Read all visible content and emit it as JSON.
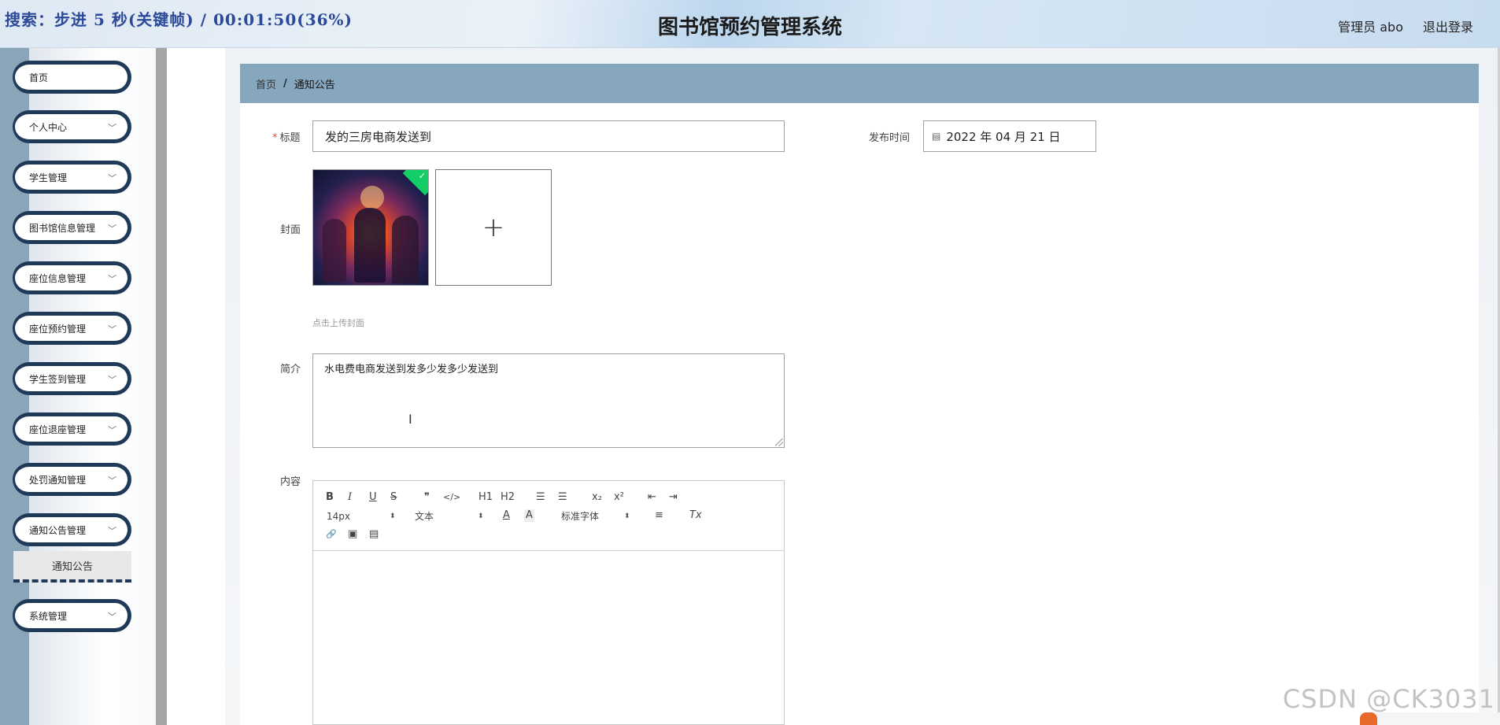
{
  "overlay_text": "搜索：步进 5 秒(关键帧) / 00:01:50(36%)",
  "header": {
    "title": "图书馆预约管理系统",
    "user": "管理员 abo",
    "logout": "退出登录"
  },
  "sidebar": {
    "items": [
      {
        "label": "首页",
        "has_arrow": false
      },
      {
        "label": "个人中心",
        "has_arrow": true
      },
      {
        "label": "学生管理",
        "has_arrow": true
      },
      {
        "label": "图书馆信息管理",
        "has_arrow": true
      },
      {
        "label": "座位信息管理",
        "has_arrow": true
      },
      {
        "label": "座位预约管理",
        "has_arrow": true
      },
      {
        "label": "学生签到管理",
        "has_arrow": true
      },
      {
        "label": "座位退座管理",
        "has_arrow": true
      },
      {
        "label": "处罚通知管理",
        "has_arrow": true
      },
      {
        "label": "通知公告管理",
        "has_arrow": true,
        "expanded": true
      },
      {
        "label": "系统管理",
        "has_arrow": true
      }
    ],
    "active_submenu": "通知公告"
  },
  "breadcrumb": {
    "home": "首页",
    "separator": "/",
    "current": "通知公告"
  },
  "form": {
    "title_label": "标题",
    "title_value": "发的三房电商发送到",
    "publish_time_label": "发布时间",
    "publish_time_value": "2022 年 04 月 21 日",
    "cover_label": "封面",
    "cover_hint": "点击上传封面",
    "summary_label": "简介",
    "summary_value": "水电费电商发送到发多少发多少发送到",
    "content_label": "内容"
  },
  "editor_toolbar": {
    "bold": "B",
    "italic": "I",
    "underline": "U",
    "strike": "S",
    "blockquote": "❞",
    "code": "</>",
    "h1": "H1",
    "h2": "H2",
    "ordered_list": "☰",
    "bullet_list": "☰",
    "subscript": "x₂",
    "superscript": "x²",
    "outdent": "⇤",
    "indent": "⇥",
    "size_value": "14px",
    "header_value": "文本",
    "color": "A",
    "background": "A",
    "font_value": "标准字体",
    "align": "≡",
    "clean": "Tx",
    "link": "🔗",
    "image": "▣",
    "video": "▤"
  },
  "watermark": "CSDN @CK3031",
  "colors": {
    "sidebar_accent": "#1f3a58",
    "breadcrumb_bg": "#87a7bf",
    "upload_success": "#13ce66"
  }
}
